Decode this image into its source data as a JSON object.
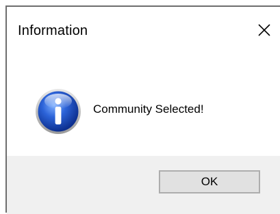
{
  "dialog": {
    "title": "Information",
    "close_icon": "close-icon",
    "message": "Community Selected!",
    "info_icon": "information-icon",
    "ok_label": "OK"
  },
  "colors": {
    "footer_bg": "#f0f0f0",
    "button_bg": "#e1e1e1",
    "button_border": "#adadad",
    "icon_blue": "#1f4fc4"
  }
}
